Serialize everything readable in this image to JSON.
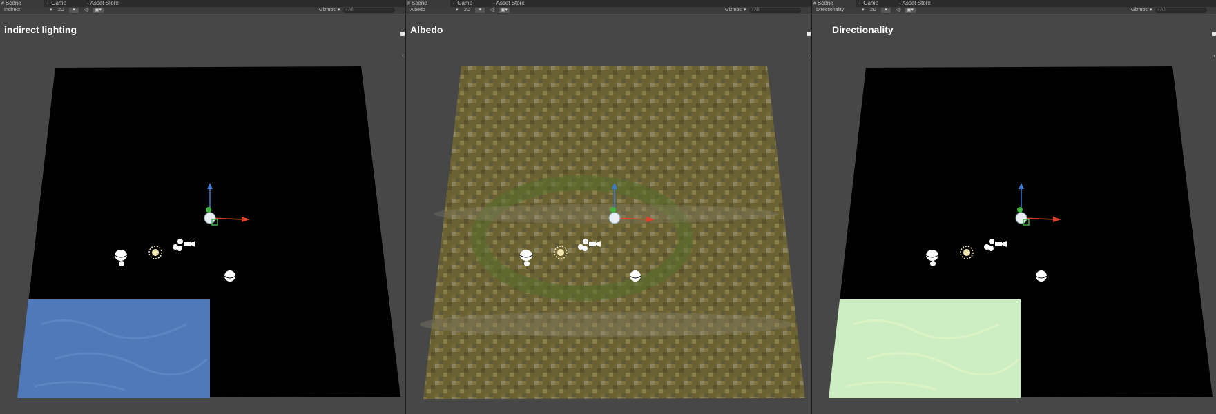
{
  "panels": [
    {
      "tabs": {
        "scene": "Scene",
        "game": "Game",
        "asset_store": "Asset Store"
      },
      "toolbar": {
        "mode": "Indirect",
        "dim": "2D",
        "gizmos": "Gizmos",
        "search_placeholder": "All"
      },
      "title": "indirect lighting",
      "view": "indirect"
    },
    {
      "tabs": {
        "scene": "Scene",
        "game": "Game",
        "asset_store": "Asset Store"
      },
      "toolbar": {
        "mode": "Albedo",
        "dim": "2D",
        "gizmos": "Gizmos",
        "search_placeholder": "All"
      },
      "title": "Albedo",
      "view": "albedo"
    },
    {
      "tabs": {
        "scene": "Scene",
        "game": "Game",
        "asset_store": "Asset Store"
      },
      "toolbar": {
        "mode": "Directionality",
        "dim": "2D",
        "gizmos": "Gizmos",
        "search_placeholder": "All"
      },
      "title": "Directionality",
      "view": "directionality"
    }
  ],
  "icons": [
    "scene-icon",
    "game-icon",
    "asset-store-icon",
    "light-icon",
    "audio-icon",
    "effects-icon",
    "light-probe-icon",
    "sun-icon",
    "camera-icon",
    "move-gizmo-icon"
  ],
  "colors": {
    "indirect_patch": "#4f79b8",
    "directionality_patch": "#cdeec3",
    "albedo_base": "#6b6234",
    "gizmo_y": "#3e7bd9",
    "gizmo_x": "#e0402a",
    "gizmo_z": "#3fb43f"
  }
}
